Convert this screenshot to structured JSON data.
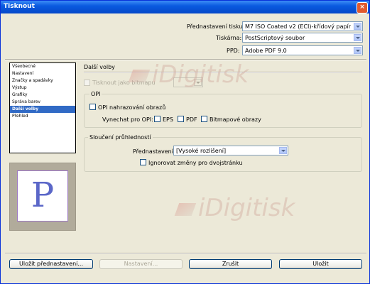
{
  "window": {
    "title": "Tisknout",
    "close": "×"
  },
  "top": {
    "preset_label": "Přednastavení tisku:",
    "preset_value": "M7 ISO Coated v2 (ECI)-křídový papír",
    "printer_label": "Tiskárna:",
    "printer_value": "PostScriptový soubor",
    "ppd_label": "PPD:",
    "ppd_value": "Adobe PDF 9.0"
  },
  "sidebar": {
    "items": [
      {
        "label": "Všeobecné"
      },
      {
        "label": "Nastavení"
      },
      {
        "label": "Značky a spadávky"
      },
      {
        "label": "Výstup"
      },
      {
        "label": "Grafiky"
      },
      {
        "label": "Správa barev"
      },
      {
        "label": "Další volby"
      },
      {
        "label": "Přehled"
      }
    ],
    "selected_index": 6
  },
  "preview": {
    "glyph": "P"
  },
  "main": {
    "section_title": "Další volby",
    "print_as_bitmap": "Tisknout jako bitmapu",
    "opi": {
      "title": "OPI",
      "replace_label": "OPI nahrazování obrazů",
      "omit_label": "Vynechat pro OPI:",
      "eps": "EPS",
      "pdf": "PDF",
      "bitmap": "Bitmapové obrazy"
    },
    "flattening": {
      "title": "Sloučení průhledností",
      "preset_label": "Přednastavení:",
      "preset_value": "[Vysoké rozlišení]",
      "ignore_label": "Ignorovat změny pro dvojstránku"
    }
  },
  "buttons": {
    "save_preset": "Uložit přednastavení...",
    "setup": "Nastavení...",
    "cancel": "Zrušit",
    "save": "Uložit"
  },
  "watermark": {
    "text": "iDigitisk"
  }
}
